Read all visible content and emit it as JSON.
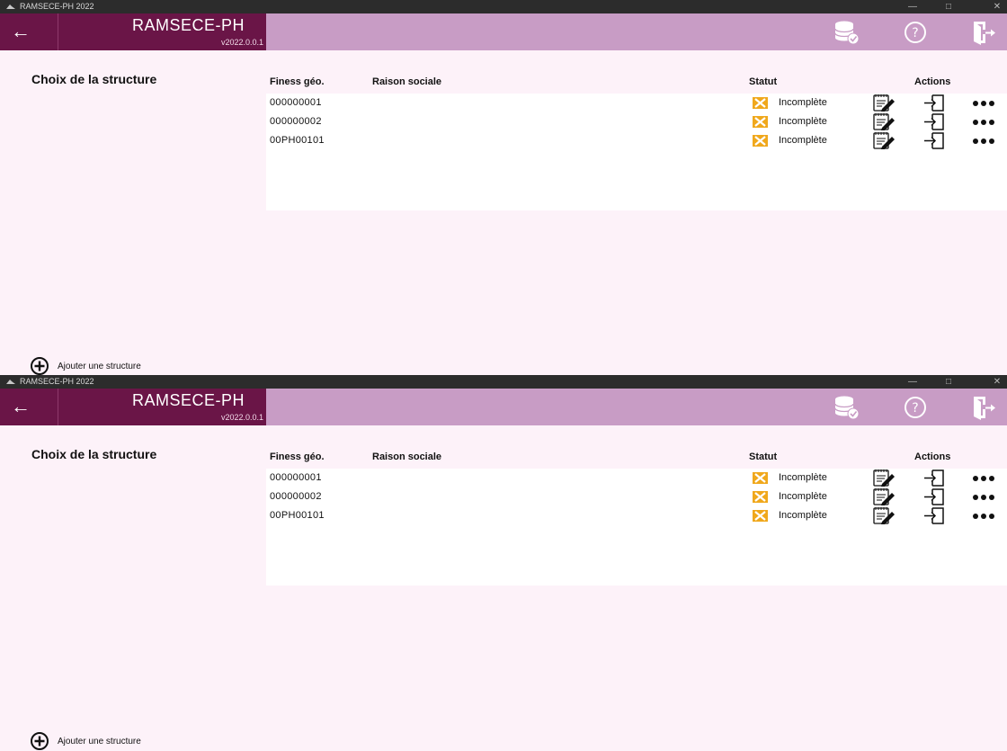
{
  "windows": [
    {
      "titlebar": {
        "title": "RAMSECE-PH 2022"
      },
      "header": {
        "app_name": "RAMSECE-PH",
        "version": "v2022.0.0.1"
      },
      "section_title": "Choix de la structure",
      "table": {
        "columns": [
          "Finess géo.",
          "Raison sociale",
          "Statut",
          "Actions"
        ],
        "rows": [
          {
            "finess": "000000001",
            "raison_sociale": "",
            "statut": "Incomplète"
          },
          {
            "finess": "000000002",
            "raison_sociale": "",
            "statut": "Incomplète"
          },
          {
            "finess": "00PH00101",
            "raison_sociale": "",
            "statut": "Incomplète"
          }
        ]
      },
      "add_button_label": "Ajouter une structure"
    },
    {
      "titlebar": {
        "title": "RAMSECE-PH 2022"
      },
      "header": {
        "app_name": "RAMSECE-PH",
        "version": "v2022.0.0.1"
      },
      "section_title": "Choix de la structure",
      "table": {
        "columns": [
          "Finess géo.",
          "Raison sociale",
          "Statut",
          "Actions"
        ],
        "rows": [
          {
            "finess": "000000001",
            "raison_sociale": "",
            "statut": "Incomplète"
          },
          {
            "finess": "000000002",
            "raison_sociale": "",
            "statut": "Incomplète"
          },
          {
            "finess": "00PH00101",
            "raison_sociale": "",
            "statut": "Incomplète"
          }
        ]
      },
      "add_button_label": "Ajouter une structure"
    }
  ],
  "colors": {
    "header_left": "#6a1547",
    "header_bar": "#c89cc5",
    "status_warning": "#f0a81c",
    "background": "#fdf2f9"
  },
  "icons": {
    "back": "arrow-left-icon",
    "database": "database-check-icon",
    "help": "help-circle-icon",
    "exit": "exit-door-icon",
    "status": "incomplete-warning-icon",
    "edit": "notepad-edit-icon",
    "enter": "enter-structure-icon",
    "more": "more-dots-icon",
    "add": "add-circle-icon"
  }
}
